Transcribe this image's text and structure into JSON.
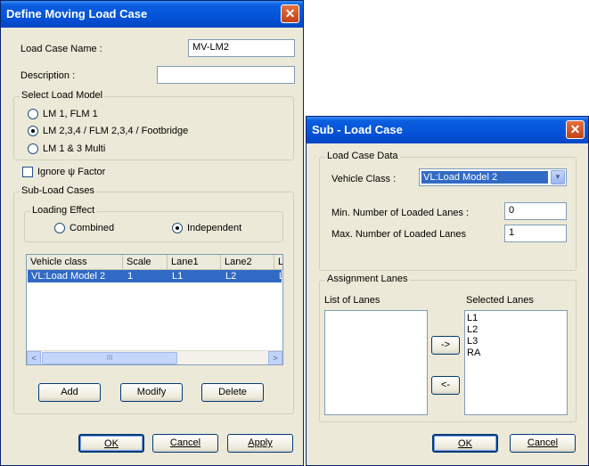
{
  "main_dialog": {
    "title": "Define Moving Load Case",
    "load_case_name_label": "Load Case Name  :",
    "load_case_name_value": "MV-LM2",
    "description_label": "Description :",
    "description_value": "",
    "select_load_model": {
      "label": "Select Load Model",
      "options": [
        {
          "label": "LM 1, FLM 1",
          "selected": false
        },
        {
          "label": "LM 2,3,4 / FLM 2,3,4 / Footbridge",
          "selected": true
        },
        {
          "label": "LM 1 & 3 Multi",
          "selected": false
        }
      ]
    },
    "ignore_factor_label": "Ignore ψ Factor",
    "ignore_factor_checked": false,
    "sub_load_cases": {
      "label": "Sub-Load Cases",
      "loading_effect": {
        "label": "Loading Effect",
        "combined_label": "Combined",
        "independent_label": "Independent",
        "selected": "Independent"
      },
      "table": {
        "headers": [
          "Vehicle class",
          "Scale",
          "Lane1",
          "Lane2",
          "L"
        ],
        "rows": [
          [
            "VL:Load Model 2",
            "1",
            "L1",
            "L2",
            "L"
          ]
        ]
      },
      "scroll_left": "<",
      "scroll_right": ">",
      "scroll_thumb": "III",
      "add_label": "Add",
      "modify_label": "Modify",
      "delete_label": "Delete"
    },
    "ok_label": "OK",
    "cancel_label": "Cancel",
    "apply_label": "Apply",
    "close_glyph": "✕"
  },
  "sub_dialog": {
    "title": "Sub - Load Case",
    "load_case_data": {
      "label": "Load Case Data",
      "vehicle_class_label": "Vehicle Class :",
      "vehicle_class_value": "VL:Load Model 2",
      "min_lanes_label": "Min. Number of Loaded Lanes :",
      "min_lanes_value": "0",
      "max_lanes_label": "Max. Number of Loaded Lanes",
      "max_lanes_value": "1"
    },
    "assignment_lanes": {
      "label": "Assignment Lanes",
      "list_of_lanes_label": "List of Lanes",
      "list_of_lanes": [],
      "selected_lanes_label": "Selected Lanes",
      "selected_lanes": [
        "L1",
        "L2",
        "L3",
        "RA"
      ],
      "add_arrow_label": "->",
      "remove_arrow_label": "<-"
    },
    "ok_label": "OK",
    "cancel_label": "Cancel",
    "close_glyph": "✕",
    "dropdown_glyph": "▼"
  }
}
